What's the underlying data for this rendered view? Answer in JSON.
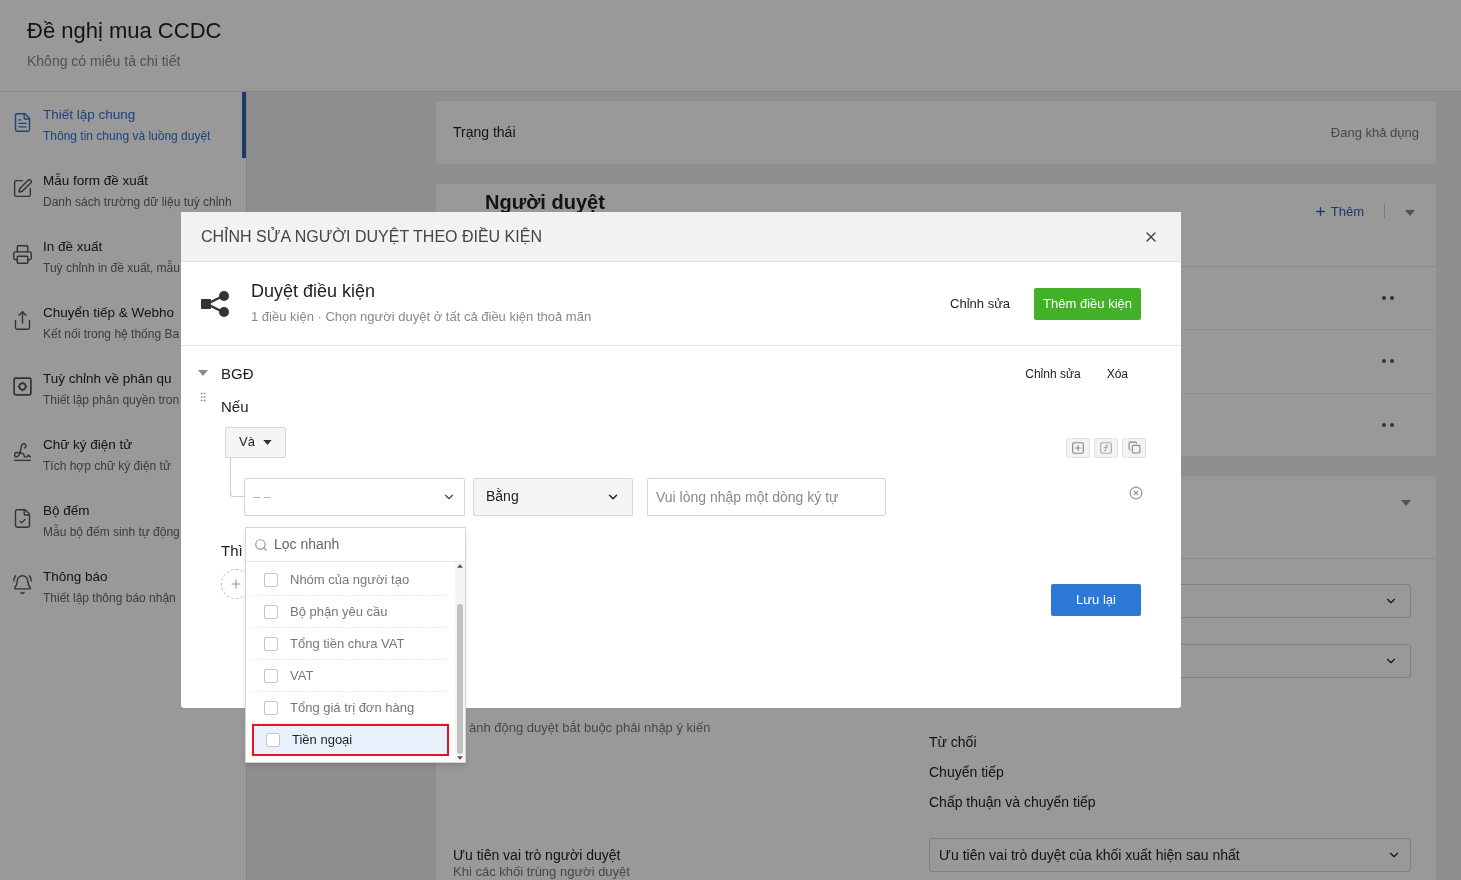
{
  "page": {
    "title": "Đề nghị mua CCDC",
    "description": "Không có miêu tả chi tiết"
  },
  "sidebar": {
    "items": [
      {
        "title": "Thiết lập chung",
        "subtitle": "Thông tin chung và luồng duyệt",
        "selected": true
      },
      {
        "title": "Mẫu form đề xuất",
        "subtitle": "Danh sách trường dữ liệu tuỳ chỉnh",
        "selected": false
      },
      {
        "title": "In đề xuất",
        "subtitle": "Tuỳ chỉnh in đề xuất, mẫu",
        "selected": false
      },
      {
        "title": "Chuyển tiếp & Webho",
        "subtitle": "Kết nối trong hệ thống Ba",
        "selected": false
      },
      {
        "title": "Tuỳ chỉnh về phân qu",
        "subtitle": "Thiết lập phân quyền tron",
        "selected": false
      },
      {
        "title": "Chữ ký điện tử",
        "subtitle": "Tích hợp chữ ký điện tử",
        "selected": false
      },
      {
        "title": "Bộ đếm",
        "subtitle": "Mẫu bộ đếm sinh tự động",
        "selected": false
      },
      {
        "title": "Thông báo",
        "subtitle": "Thiết lập thông báo nhận",
        "selected": false
      }
    ]
  },
  "status_card": {
    "label": "Trạng thái",
    "value": "Đang khả dụng"
  },
  "approvers_card": {
    "title": "Người duyệt",
    "add_button": "Thêm"
  },
  "settings_card": {
    "comment_hint": "ành động duyệt bắt buộc phải nhập ý kiến",
    "actions": [
      "Từ chối",
      "Chuyển tiếp",
      "Chấp thuận và chuyển tiếp"
    ],
    "priority": {
      "label": "Ưu tiên vai trò người duyệt",
      "hint": "Khi các khối trùng người duyệt",
      "value": "Ưu tiên vai trò duyệt của khối xuất hiện sau nhất"
    }
  },
  "modal": {
    "title": "CHỈNH SỬA NGƯỜI DUYỆT THEO ĐIỀU KIỆN",
    "summary": {
      "title": "Duyệt điều kiện",
      "subtitle": "1 điều kiện · Chọn người duyệt ở tất cả điều kiện thoả mãn",
      "edit_button": "Chỉnh sửa",
      "add_button": "Thêm điều kiện"
    },
    "block": {
      "name": "BGĐ",
      "expanded": true,
      "edit_button": "Chỉnh sửa",
      "delete_button": "Xóa",
      "if_label": "Nếu",
      "operator": "Và",
      "condition": {
        "field": "– –",
        "comparator": "Bằng",
        "value_placeholder": "Vui lòng nhập một dòng ký tự"
      },
      "then_label": "Thì"
    },
    "save_button": "Lưu lại"
  },
  "dropdown": {
    "search_placeholder": "Lọc nhanh",
    "options": [
      {
        "label": "Nhóm của người tạo",
        "checked": false,
        "highlighted": false
      },
      {
        "label": "Bộ phận yêu cầu",
        "checked": false,
        "highlighted": false
      },
      {
        "label": "Tổng tiền chưa VAT",
        "checked": false,
        "highlighted": false
      },
      {
        "label": "VAT",
        "checked": false,
        "highlighted": false
      },
      {
        "label": "Tổng giá trị đơn hàng",
        "checked": false,
        "highlighted": false
      },
      {
        "label": "Tiền ngoại",
        "checked": false,
        "highlighted": true
      }
    ]
  }
}
